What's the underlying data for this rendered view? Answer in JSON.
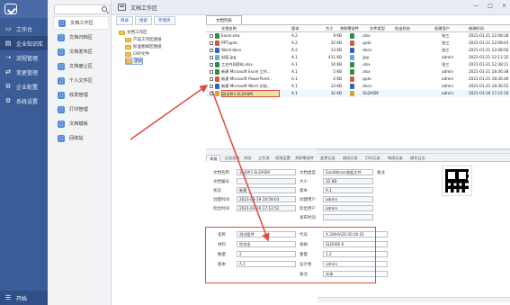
{
  "nav": {
    "items": [
      {
        "label": "工作台",
        "icon": "monitor-icon"
      },
      {
        "label": "企业知识库",
        "icon": "book-icon"
      },
      {
        "label": "流程管理",
        "icon": "flow-icon"
      },
      {
        "label": "变更管理",
        "icon": "change-icon"
      },
      {
        "label": "企业配置",
        "icon": "settings-icon"
      },
      {
        "label": "系统设置",
        "icon": "gear-icon"
      }
    ],
    "start": "开始"
  },
  "modules": [
    "文档工作区",
    "文档归档区",
    "文档发布区",
    "文档废止区",
    "个人文件区",
    "收发管理",
    "打印管理",
    "文档模板",
    "回收站"
  ],
  "window": {
    "title": "文档工作区",
    "controls": [
      "—",
      "□",
      "×"
    ]
  },
  "toolbar": {
    "buttons": [
      "目录",
      "搜索",
      "存储夹"
    ]
  },
  "tree": {
    "root": "文档工作区",
    "children": [
      "产品工作区图纸",
      "标准图样区图纸",
      "CRP文件",
      "测试"
    ]
  },
  "file_list": {
    "tab": "文档列表",
    "columns": [
      "文档名称",
      "版本",
      "大小",
      "关联零部件",
      "文件类型",
      "检出状态",
      "创建用户",
      "修改时间"
    ],
    "rows": [
      {
        "name": "Excel.xlsx",
        "version": "A.2",
        "size": "9 KB",
        "type": ".xlsx",
        "creator": "张三",
        "date": "2021-01-21 12:08:18"
      },
      {
        "name": "PPT.pptx",
        "version": "A.2",
        "size": "32 KB",
        "type": ".pptx",
        "creator": "张三",
        "date": "2021-01-21 12:08:43"
      },
      {
        "name": "Word.docx",
        "version": "A.2",
        "size": "13 KB",
        "type": ".docx",
        "creator": "张三",
        "date": "2021-01-21 12:08:50"
      },
      {
        "name": "封面.jpg",
        "version": "A.1",
        "size": "411 KB",
        "type": ".jpg",
        "creator": "admin",
        "date": "2021-01-21 12:11:32"
      },
      {
        "name": "工艺共同资料.xlsx",
        "version": "A.1",
        "size": "10 KB",
        "type": ".xlsx",
        "creator": "张三",
        "date": "2021-01-21 12:38:11"
      },
      {
        "name": "新建 Microsoft Excel 工作...",
        "version": "A.1",
        "size": "5 KB",
        "type": ".xlsx",
        "creator": "admin",
        "date": "2021-01-21 18:36:38"
      },
      {
        "name": "新建 Microsoft PowerPoint...",
        "version": "A.1",
        "size": "0 KB",
        "type": ".pptx",
        "creator": "admin",
        "date": "2021-01-21 18:36:46"
      },
      {
        "name": "新建 Microsoft Word 文档...",
        "version": "A.1",
        "size": "12 KB",
        "type": ".docx",
        "creator": "admin",
        "date": "2021-01-21 18:36:52"
      },
      {
        "name": "测试件1.SLDASM",
        "version": "A.1",
        "size": "32 KB",
        "type": ".SLDASM",
        "creator": "admin",
        "date": "2021-03-19 17:22:16"
      }
    ]
  },
  "detail_tabs": [
    "常规",
    "历史版本",
    "浏览",
    "工作流",
    "权限设置",
    "关联零部件",
    "变更记录",
    "借阅记录",
    "打印记录",
    "审阅记录",
    "操作日志"
  ],
  "details": {
    "doc_name_label": "文档名称",
    "doc_name": "测试件1.SLDASM",
    "doc_type_label": "文档类型",
    "doc_type": "SolidWorks装配文件",
    "remark_label": "备注",
    "doc_number_label": "文档编号",
    "doc_number": "",
    "size_label": "大小",
    "size": "32 KB",
    "status_label": "状态",
    "status": "新建",
    "version_label": "版本",
    "version": "A.1",
    "created_label": "创建时间",
    "created": "2021-03-19 16:58:03",
    "creator_label": "创建用户",
    "creator": "admin",
    "modified_label": "检出时间",
    "modified": "2021-03-19 17:12:52",
    "checkout_user_label": "检出用户",
    "checkout_user": "admin",
    "publish_label": "发布时间",
    "publish": ""
  },
  "properties": {
    "name_label": "名称",
    "name": "测试组件",
    "code_label": "代号",
    "code": "X.2004A26.00.00.01",
    "material_label": "材料",
    "material": "铝合金",
    "spec_label": "规格",
    "spec": "SLD006-6",
    "quantity_label": "数量",
    "quantity": "2",
    "weight_label": "重量",
    "weight": "1.2",
    "version_label": "版本",
    "version": "A.1",
    "designer_label": "设计者",
    "designer": "admin",
    "note_label": "备注",
    "note": "实体"
  },
  "colors": {
    "nav_bg": "#3b5d97",
    "accent": "#4e8ad5",
    "highlight_red": "#e24a3f"
  }
}
